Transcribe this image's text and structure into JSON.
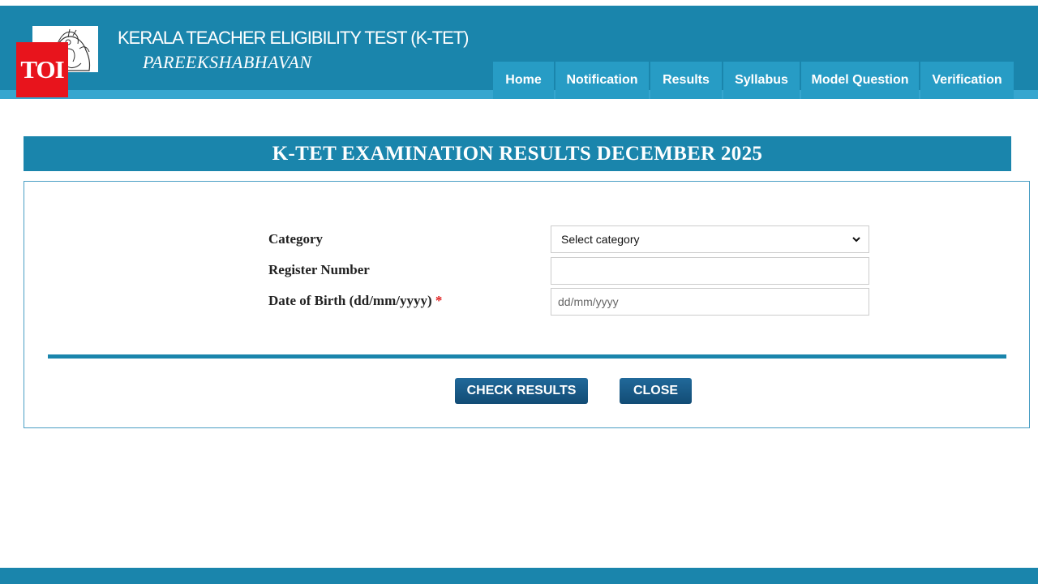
{
  "header": {
    "title": "KERALA TEACHER ELIGIBILITY TEST (K-TET)",
    "subtitle": "PAREEKSHABHAVAN",
    "emblem_icon": "kerala-emblem-icon",
    "watermark": "TOI"
  },
  "nav": {
    "items": [
      {
        "label": "Home"
      },
      {
        "label": "Notification"
      },
      {
        "label": "Results"
      },
      {
        "label": "Syllabus"
      },
      {
        "label": "Model Question"
      },
      {
        "label": "Verification"
      }
    ]
  },
  "main": {
    "title": "K-TET EXAMINATION RESULTS DECEMBER 2025"
  },
  "form": {
    "category_label": "Category",
    "category_selected": "Select category",
    "register_label": "Register Number",
    "register_value": "",
    "dob_label": "Date of Birth (dd/mm/yyyy)",
    "dob_required_mark": "*",
    "dob_placeholder": "dd/mm/yyyy"
  },
  "buttons": {
    "check_results": "CHECK RESULTS",
    "close": "CLOSE"
  },
  "colors": {
    "header_bg": "#1a85ac",
    "nav_bg": "#279cc5",
    "button_bg": "#1a5a87",
    "required": "#e02020",
    "toi_red": "#e8141c"
  }
}
